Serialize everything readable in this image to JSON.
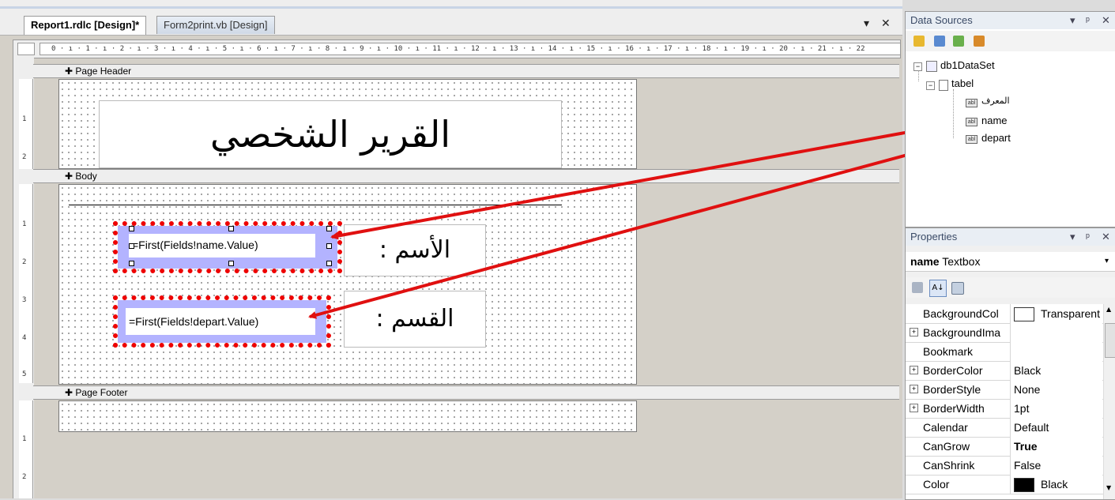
{
  "tabs": [
    {
      "label": "Report1.rdlc [Design]*",
      "active": true
    },
    {
      "label": "Form2print.vb [Design]",
      "active": false
    }
  ],
  "tab_controls": {
    "dropdown": "▾",
    "close": "✕"
  },
  "ruler": "0 · ı · 1 · ı · 2 · ı · 3 · ı · 4 · ı · 5 · ı · 6 · ı · 7 · ı · 8 · ı · 9 · ı · 10 · ı · 11 · ı · 12 · ı · 13 · ı · 14 · ı · 15 · ı · 16 · ı · 17 · ı · 18 · ı · 19 · ı · 20 · ı · 21 · ı · 22",
  "bands": {
    "page_header": "Page Header",
    "body": "Body",
    "page_footer": "Page Footer"
  },
  "report": {
    "title": "القرير الشخصي",
    "name_label": "الأسم :",
    "name_expr": "=First(Fields!name.Value)",
    "depart_label": "القسم :",
    "depart_expr": "=First(Fields!depart.Value)"
  },
  "vruler_marks": {
    "header": [
      "1",
      "2"
    ],
    "body": [
      "1",
      "2",
      "3",
      "4",
      "5"
    ],
    "footer": [
      "1",
      "2"
    ]
  },
  "data_sources": {
    "title": "Data Sources",
    "controls": [
      "▾",
      "ᵖ",
      "✕"
    ],
    "tree": {
      "dataset": "db1DataSet",
      "table": "tabel",
      "fields": [
        "المعرف",
        "name",
        "depart"
      ]
    }
  },
  "properties": {
    "title": "Properties",
    "controls": [
      "▾",
      "ᵖ",
      "✕"
    ],
    "object_name": "name",
    "object_type": "Textbox",
    "rows": [
      {
        "name": "BackgroundCol",
        "value": "Transparent",
        "expand": false,
        "swatch": "#ffffff"
      },
      {
        "name": "BackgroundIma",
        "value": "",
        "expand": true
      },
      {
        "name": "Bookmark",
        "value": "",
        "expand": false
      },
      {
        "name": "BorderColor",
        "value": "Black",
        "expand": true
      },
      {
        "name": "BorderStyle",
        "value": "None",
        "expand": true
      },
      {
        "name": "BorderWidth",
        "value": "1pt",
        "expand": true
      },
      {
        "name": "Calendar",
        "value": "Default",
        "expand": false
      },
      {
        "name": "CanGrow",
        "value": "True",
        "expand": false,
        "bold": true
      },
      {
        "name": "CanShrink",
        "value": "False",
        "expand": false
      },
      {
        "name": "Color",
        "value": "Black",
        "expand": false,
        "swatch": "#000000"
      }
    ]
  },
  "colors": {
    "arrow": "#e01010",
    "selection_fill": "#b3b3ff",
    "selection_dots": "#e00000"
  }
}
